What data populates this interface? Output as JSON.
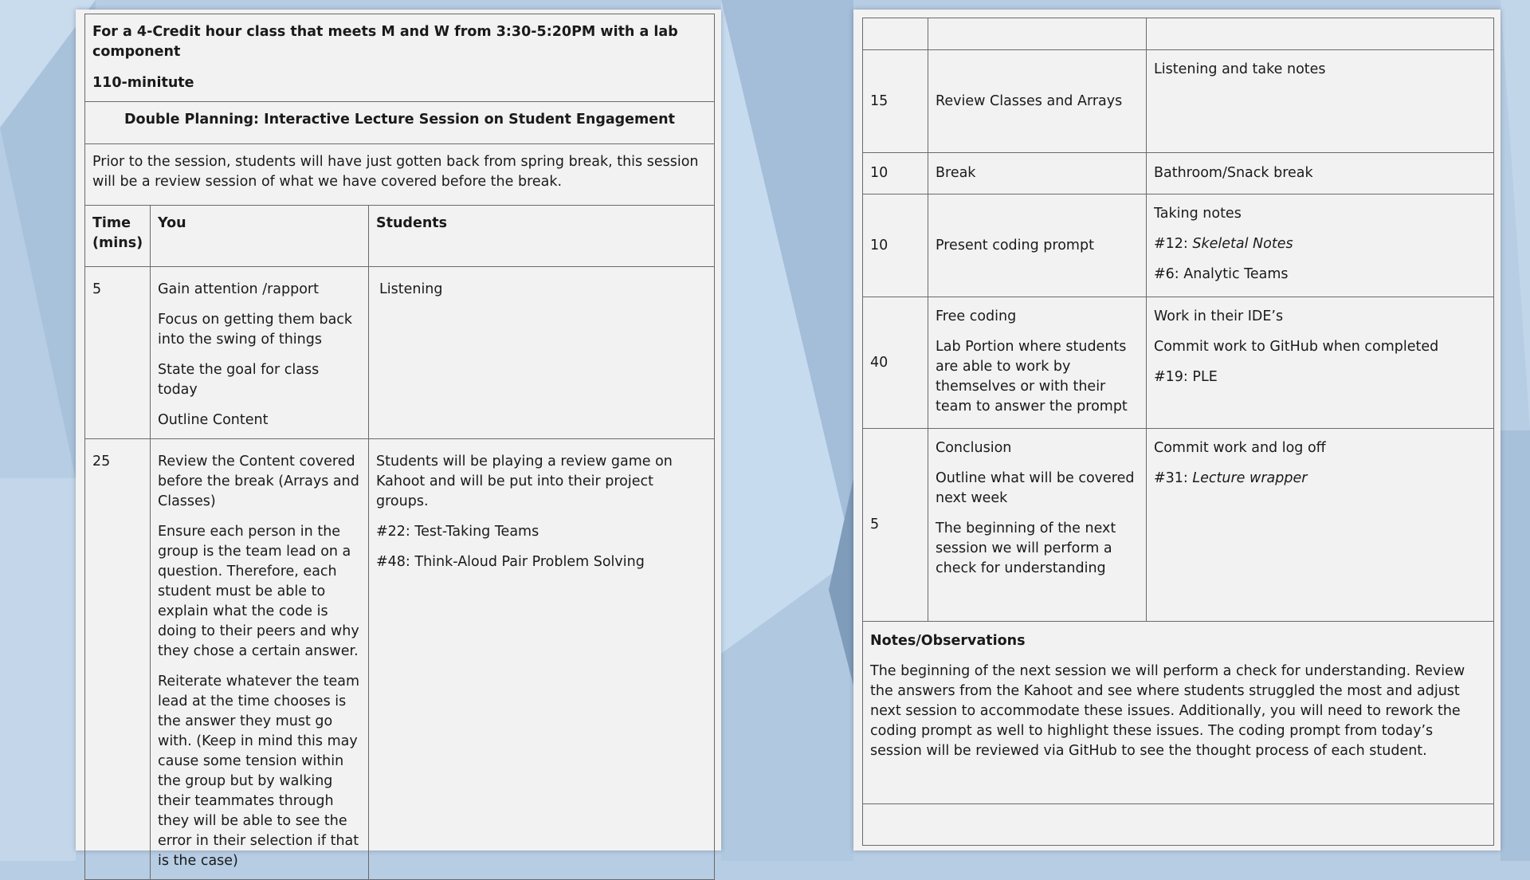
{
  "colors": {
    "background": "#b7cde3",
    "paper": "#f2f2f2",
    "rule": "#6a6a6a"
  },
  "left_page": {
    "header_line1": "For a 4-Credit hour class that meets M and W from 3:30-5:20PM with a lab component",
    "header_line2": "110-minitute",
    "title": "Double Planning: Interactive Lecture Session on Student Engagement",
    "intro": "Prior to the session, students will have just gotten back from spring break, this session will be a review session of what we have covered before the break.",
    "columns": {
      "time": "Time (mins)",
      "you": "You",
      "students": "Students"
    },
    "rows": [
      {
        "time": "5",
        "you": [
          "Gain attention /rapport",
          "Focus on getting them back into the swing of things",
          "State the goal for class today",
          "Outline Content"
        ],
        "students": [
          "Listening"
        ]
      },
      {
        "time": "25",
        "you": [
          "Review the Content covered before the break (Arrays and Classes)",
          "Ensure each person in the group is the team lead on a question. Therefore, each student must be able to explain what the code is doing to their peers and why they chose a certain answer.",
          "Reiterate whatever the team lead at the time chooses is the answer they must go with. (Keep in mind this may cause some tension within the group but by walking their teammates through they will be able to see the error in their selection if that is the case)"
        ],
        "students": [
          "Students will be playing a review game on Kahoot and will be put into their project groups.",
          "#22: Test-Taking Teams",
          "#48: Think-Aloud Pair Problem Solving"
        ]
      }
    ]
  },
  "right_page": {
    "rows": [
      {
        "time": "15",
        "you": [
          "Review Classes and Arrays"
        ],
        "students": [
          "Listening and take notes"
        ]
      },
      {
        "time": "10",
        "you": [
          "Break"
        ],
        "students": [
          "Bathroom/Snack break"
        ]
      },
      {
        "time": "10",
        "you": [
          "Present coding prompt"
        ],
        "students": [
          "Taking notes"
        ],
        "students_prefix_a": "#12: ",
        "students_italic_a": "Skeletal Notes",
        "students_after": "#6: Analytic Teams"
      },
      {
        "time": "40",
        "you": [
          "Free coding",
          "Lab Portion where students are able to work by themselves or with their team to answer the prompt"
        ],
        "students": [
          "Work in their IDE’s",
          "Commit work to GitHub when completed",
          "#19: PLE"
        ]
      },
      {
        "time": "5",
        "you": [
          "Conclusion",
          "Outline what will be covered next week",
          "The beginning of the next session we will perform a check for understanding"
        ],
        "students": [
          "Commit work and log off"
        ],
        "students_prefix_b": "#31: ",
        "students_italic_b": "Lecture wrapper"
      }
    ],
    "notes_heading": "Notes/Observations",
    "notes_body": "The beginning of the next session we will perform a check for understanding. Review the answers from the Kahoot and see where students struggled the most and adjust next session to accommodate these issues. Additionally, you will need to rework the coding prompt as well to highlight these issues. The coding prompt from today’s session will be reviewed via GitHub to see the thought process of each student."
  }
}
